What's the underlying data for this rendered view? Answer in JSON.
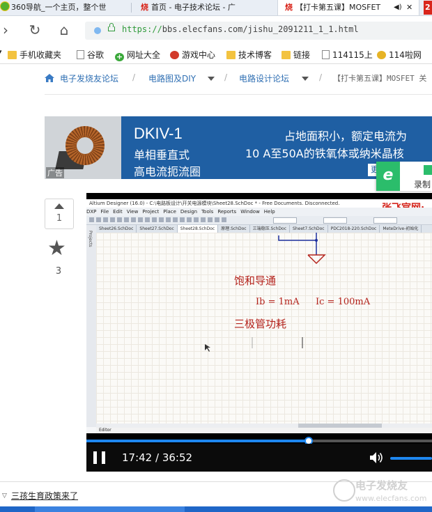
{
  "browser": {
    "tabs": [
      {
        "label": "360导航_一个主页，整个世",
        "active": false
      },
      {
        "label": "首页 - 电子技术论坛 - 广",
        "active": false
      },
      {
        "label": "【打卡第五课】MOSFET",
        "active": true
      }
    ],
    "corner_badge": "2",
    "url_scheme": "https://",
    "url_rest": "bbs.elecfans.com/jishu_2091211_1_1.html"
  },
  "bookmarks": [
    {
      "label": "手机收藏夹",
      "icon": "folder-icon"
    },
    {
      "label": "谷歌",
      "icon": "page-icon"
    },
    {
      "label": "网址大全",
      "icon": "plus-circle-icon"
    },
    {
      "label": "游戏中心",
      "icon": "game-icon"
    },
    {
      "label": "技术博客",
      "icon": "folder-icon"
    },
    {
      "label": "链接",
      "icon": "folder-icon"
    },
    {
      "label": "114115上",
      "icon": "page-icon"
    },
    {
      "label": "114啦网",
      "icon": "gold-icon"
    }
  ],
  "breadcrumb": {
    "items": [
      "电子发烧友论坛",
      "电路图及DIY",
      "电路设计论坛",
      "【打卡第五课】MOSFET 关"
    ]
  },
  "ad": {
    "model": "DKIV-1",
    "line1": "单相垂直式",
    "line2": "高电流扼流圈",
    "right1": "占地面积小，额定电流为",
    "right2": "10 A至50A的铁氧体或纳米晶核",
    "tag": "更",
    "label": "广告"
  },
  "recorder": {
    "label": "录制"
  },
  "post": {
    "vote_count": "1",
    "star_count": "3"
  },
  "video": {
    "window_title": "Altium Designer (16.0) - C:\\电路板设计\\开关电源模块\\Sheet28.SchDoc * - Free Documents. Disconnected.",
    "menu": [
      "DXP",
      "File",
      "Edit",
      "View",
      "Project",
      "Place",
      "Design",
      "Tools",
      "Reports",
      "Window",
      "Help"
    ],
    "doc_tabs": [
      "Sheet26.SchDoc",
      "Sheet27.SchDoc",
      "Sheet28.SchDoc",
      "原理.SchDoc",
      "三端稳压.SchDoc",
      "Sheet7.SchDoc",
      "PDC2018-220.SchDoc",
      "MeteDrive-初始化"
    ],
    "side_panel": "Projects",
    "editor_tab": "Editor",
    "logo": "张飞官网:",
    "schematic_text": {
      "title": "饱和导通",
      "ib": "Ib = 1mA",
      "ic": "Ic = 100mA",
      "note": "三极管功耗"
    },
    "time": "17:42 / 36:52",
    "progress": 0.643,
    "volume": 1.0
  },
  "footer": {
    "link": "三孩生育政策来了",
    "watermark_text": "电子发烧友",
    "watermark_url": "www.elecfans.com"
  },
  "colors": {
    "link": "#2f6fb3",
    "accent": "#1e87f0",
    "schematic_red": "#b4231c",
    "ad_blue": "#1f5fa3"
  }
}
